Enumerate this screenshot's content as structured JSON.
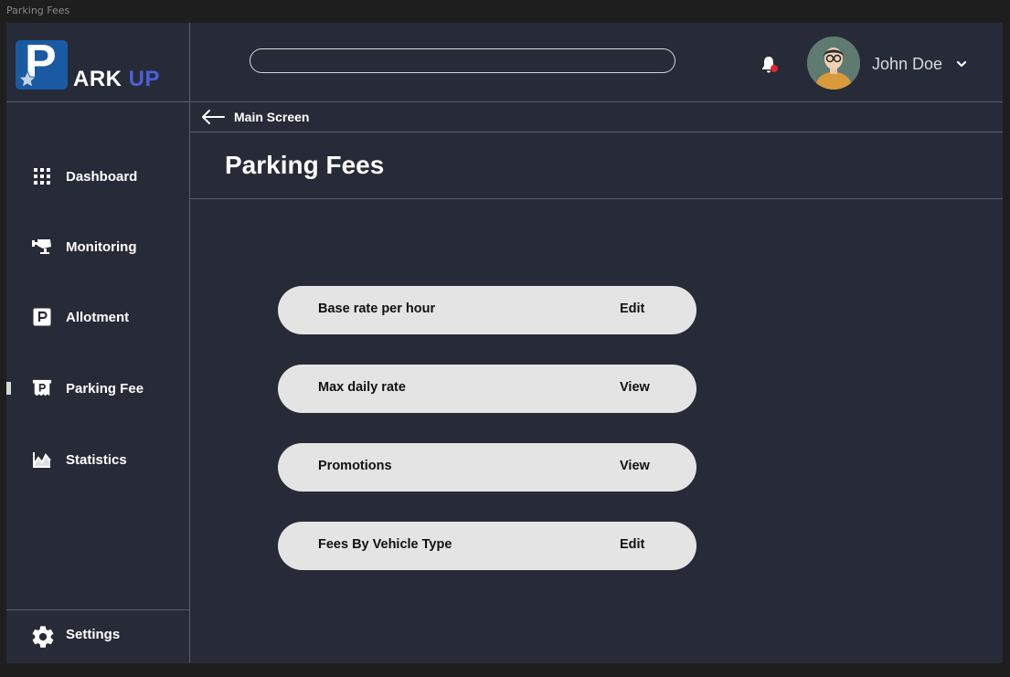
{
  "window": {
    "title": "Parking Fees"
  },
  "logo": {
    "letter": "P",
    "text_main": "ARK",
    "text_accent": "UP",
    "accent_color": "#4a5fd8",
    "badge_color": "#1a5aa3"
  },
  "search": {
    "value": "",
    "placeholder": ""
  },
  "user": {
    "name": "John Doe",
    "notification_dot_color": "#e0252b"
  },
  "sidebar": {
    "items": [
      {
        "label": "Dashboard",
        "icon": "grid-icon"
      },
      {
        "label": "Monitoring",
        "icon": "camera-icon"
      },
      {
        "label": "Allotment",
        "icon": "parking-sign-icon"
      },
      {
        "label": "Parking Fee",
        "icon": "parking-ticket-icon",
        "active": true
      },
      {
        "label": "Statistics",
        "icon": "chart-icon"
      }
    ],
    "settings_label": "Settings"
  },
  "breadcrumb": {
    "back_label": "Main Screen"
  },
  "page": {
    "title": "Parking Fees"
  },
  "fees": [
    {
      "label": "Base rate per hour",
      "action": "Edit"
    },
    {
      "label": "Max daily rate",
      "action": "View"
    },
    {
      "label": "Promotions",
      "action": "View"
    },
    {
      "label": "Fees By Vehicle Type",
      "action": "Edit"
    }
  ]
}
